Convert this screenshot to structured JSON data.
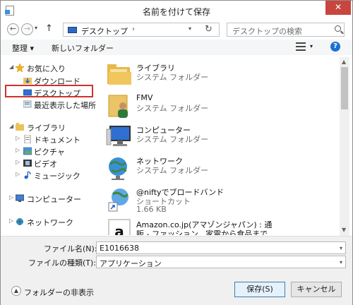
{
  "window": {
    "title": "名前を付けて保存",
    "close_label": "✕"
  },
  "nav": {
    "back_icon": "←",
    "forward_icon": "→",
    "up_icon": "↑",
    "address": {
      "location": "デスクトップ",
      "chevron": "›"
    },
    "search_placeholder": "デスクトップの検索"
  },
  "toolbar": {
    "organize_label": "整理 ▾",
    "new_folder_label": "新しいフォルダー",
    "help_label": "?"
  },
  "sidebar": {
    "favorites": "お気に入り",
    "downloads": "ダウンロード",
    "desktop": "デスクトップ",
    "recent": "最近表示した場所",
    "libraries": "ライブラリ",
    "documents": "ドキュメント",
    "pictures": "ピクチャ",
    "videos": "ビデオ",
    "music": "ミュージック",
    "computer": "コンピューター",
    "network": "ネットワーク"
  },
  "files": [
    {
      "name": "ライブラリ",
      "type": "システム フォルダー",
      "icon": "library-folder-icon"
    },
    {
      "name": "FMV",
      "type": "システム フォルダー",
      "icon": "user-folder-icon"
    },
    {
      "name": "コンピューター",
      "type": "システム フォルダー",
      "icon": "computer-icon"
    },
    {
      "name": "ネットワーク",
      "type": "システム フォルダー",
      "icon": "network-icon"
    },
    {
      "name": "@niftyでブロードバンド",
      "type": "ショートカット",
      "size": "1.66 KB",
      "icon": "globe-shortcut-icon"
    },
    {
      "name": "Amazon.co.jp(アマゾンジャパン) : 通",
      "name2": "販 - ファッション、家電から食品まで",
      "icon": "amazon-icon"
    }
  ],
  "save_form": {
    "filename_label": "ファイル名(N):",
    "filename_value": "E1016638",
    "filetype_label": "ファイルの種類(T):",
    "filetype_value": "アプリケーション"
  },
  "footer": {
    "hide_folders_label": "フォルダーの非表示",
    "save_button": "保存(S)",
    "cancel_button": "キャンセル"
  },
  "colors": {
    "highlight_border": "#d0312d",
    "close_button": "#c7463f",
    "accent": "#1e6fd3"
  }
}
